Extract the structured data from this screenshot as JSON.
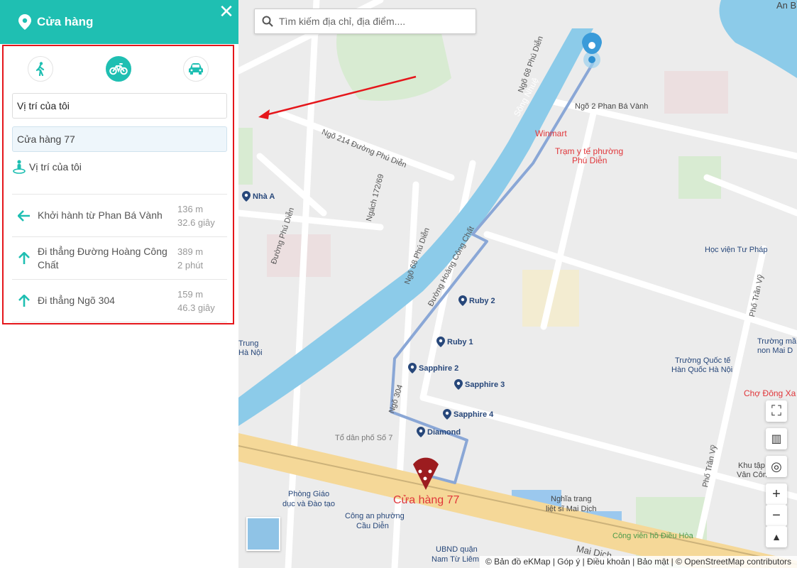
{
  "panel": {
    "title": "Cửa hàng",
    "close_label": "✕",
    "origin_value": "Vị trí của tôi",
    "destination_value": "Cửa hàng 77",
    "my_location_label": "Vị trí của tôi",
    "steps": [
      {
        "instruction": "Khởi hành từ Phan Bá Vành",
        "distance": "136 m",
        "duration": "32.6 giây",
        "arrow": "left"
      },
      {
        "instruction": "Đi thẳng Đường Hoàng Công Chất",
        "distance": "389 m",
        "duration": "2 phút",
        "arrow": "up"
      },
      {
        "instruction": "Đi thẳng Ngõ 304",
        "distance": "159 m",
        "duration": "46.3 giây",
        "arrow": "up"
      }
    ],
    "modes": [
      "walk-icon",
      "motorbike-icon",
      "car-icon"
    ],
    "active_mode": "motorbike-icon"
  },
  "map": {
    "search_placeholder": "Tìm kiếm địa chỉ, địa điểm....",
    "labels": {
      "song_nhue": "Sông Nhuệ",
      "ngo2": "Ngõ 2 Phan Bá Vành",
      "winmart": "Winmart",
      "tram_yte": "Trạm y tế phường",
      "phu_dien": "Phú Diễn",
      "ngo214": "Ngõ 214 Đường Phú Diễn",
      "ngach": "Ngách 172/69",
      "duong_phu_dien": "Đường Phú Diễn",
      "ngo68a": "Ngõ 68 Phú Diễn",
      "ngo68b": "Ngõ 68 Phú Diễn",
      "hoang_cong_chat": "Đường Hoàng Công Chất",
      "ngo304": "Ngõ 304",
      "to_dan_pho": "Tổ dân phố Số 7",
      "hoc_vien": "Học viện Tư Pháp",
      "pho_tran_vy": "Phố Trần Vỹ",
      "pho_tran_vy2": "Phố Trần Vỹ",
      "truong_quoc_te1": "Trường Quốc tế",
      "truong_quoc_te2": "Hàn Quốc Hà Nội",
      "truong_mn1": "Trường mầ",
      "truong_mn2": "non Mai D",
      "cho_dong_xa": "Chợ Đông Xa",
      "khu_tap1": "Khu tập",
      "khu_tap2": "Vân Côn",
      "nghia_trang1": "Nghĩa trang",
      "nghia_trang2": "liệt sĩ Mai Dịch",
      "cong_vien": "Công viên hồ Điều Hòa",
      "phong_gd1": "Phòng Giáo",
      "phong_gd2": "dục và Đào tạo",
      "cong_an1": "Công an phường",
      "cong_an2": "Cầu Diễn",
      "ubnd1": "UBND quận",
      "ubnd2": "Nam Từ Liêm",
      "trung": "Trung",
      "ha_noi": "Hà Nội",
      "an_binh": "An Bìn",
      "mai_dich": "Mai Dịch",
      "store": "Cửa hàng 77"
    },
    "pois": {
      "nha_a": "Nhà A",
      "ruby2": "Ruby 2",
      "ruby1": "Ruby 1",
      "sapphire2": "Sapphire 2",
      "sapphire3": "Sapphire 3",
      "sapphire4": "Sapphire 4",
      "diamond": "Diamond"
    },
    "attribution": "© Bản đồ eKMap | Góp ý | Điều khoản | Bảo mật | © OpenStreetMap contributors"
  },
  "colors": {
    "accent": "#1fbfb2",
    "highlight_border": "#e5161b",
    "route": "#8aa7d6",
    "river": "#8ccbe9",
    "store": "#9c1c1f"
  }
}
